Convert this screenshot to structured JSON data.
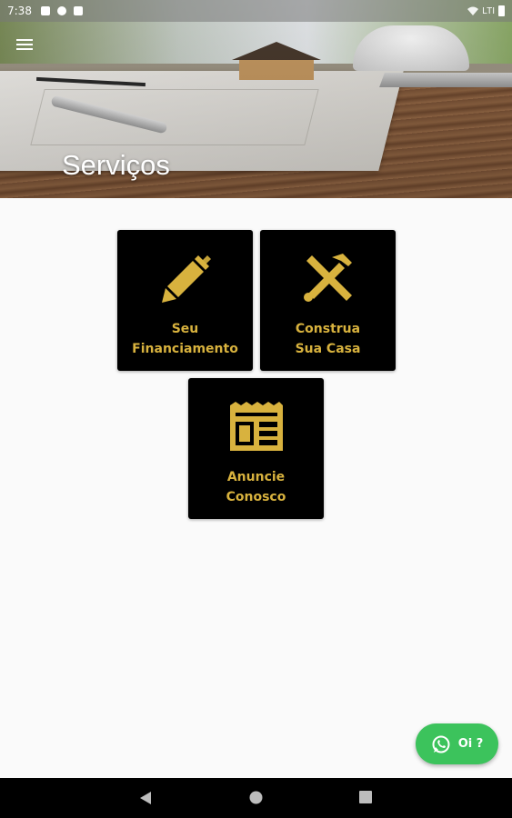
{
  "status_bar": {
    "time": "7:38",
    "network": "LTI"
  },
  "header": {
    "title": "Serviços",
    "menu_icon": "hamburger-menu-icon"
  },
  "services": [
    {
      "label": "Seu\nFinanciamento",
      "icon": "pencil-icon"
    },
    {
      "label": "Construa\nSua Casa",
      "icon": "tools-icon"
    },
    {
      "label": "Anuncie\nConosco",
      "icon": "newspaper-icon"
    }
  ],
  "whatsapp": {
    "label": "Oi ?",
    "icon": "whatsapp-icon",
    "color": "#3cc35c"
  },
  "colors": {
    "accent": "#d8b23e",
    "card_bg": "#000000",
    "page_bg": "#fafafa"
  },
  "nav": {
    "back_icon": "back-triangle-icon",
    "home_icon": "home-circle-icon",
    "recents_icon": "recents-square-icon"
  }
}
